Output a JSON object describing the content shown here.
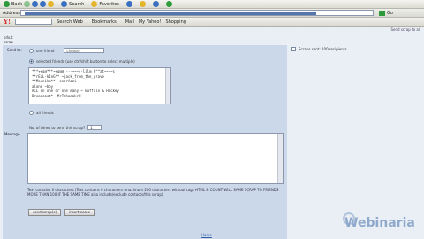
{
  "browser": {
    "toolbar": {
      "back": "Back",
      "search": "Search",
      "favorites": "Favorites"
    },
    "address": {
      "label": "Address",
      "go": "Go"
    },
    "toolbar3": {
      "yahoo": "Y!",
      "search_web": "Search Web",
      "bookmarks": "Bookmarks",
      "mail": "Mail",
      "my_yahoo": "My Yahoo!",
      "shopping": "Shopping"
    }
  },
  "page": {
    "top_links": "Send scrap to all",
    "header_line1": "orkut",
    "header_line2": "scrap",
    "send_to_label": "Send to:",
    "opt_one_friend": "one friend",
    "friend_select": "choose",
    "opt_selected_friends": "selected friends (use ctrl/shift button to select multiple)",
    "friends": [
      "***++g@***~+g@@ ---~~~s-lil@ k^^at~~~~s",
      "**rEaL-kInG** ~jack_from_the_grave",
      "**Mounika** ~cocrAzzi",
      "alone ~boy",
      "ALL on one or one many ~ Buffalo & Hockey",
      "Broadcast* ~MrTchaaakrH"
    ],
    "opt_all_friends": "all friends",
    "num_label": "No. of times to send this scrap?",
    "num_value": "1",
    "message_label": "Message",
    "note": "Text contains 0 characters (Text contains 0 characters (maximum 200 characters without tags HTML & COUNT WILL SAME SCRAP TO FRIENDS MORE THAN 100 IF THE SAME TIME also include/exclude contacts/this scrap)",
    "send_button": "send scrap(s)",
    "insert_button": "insert name",
    "right_note": "Scraps sent: 100 recipients",
    "bottom_link": "Home",
    "logo": "Webinaria"
  },
  "colors": {
    "panel": "#cbd8ea",
    "page_bg": "#eaeef5",
    "link": "#335ea8",
    "logo": "#8ea9cc"
  }
}
